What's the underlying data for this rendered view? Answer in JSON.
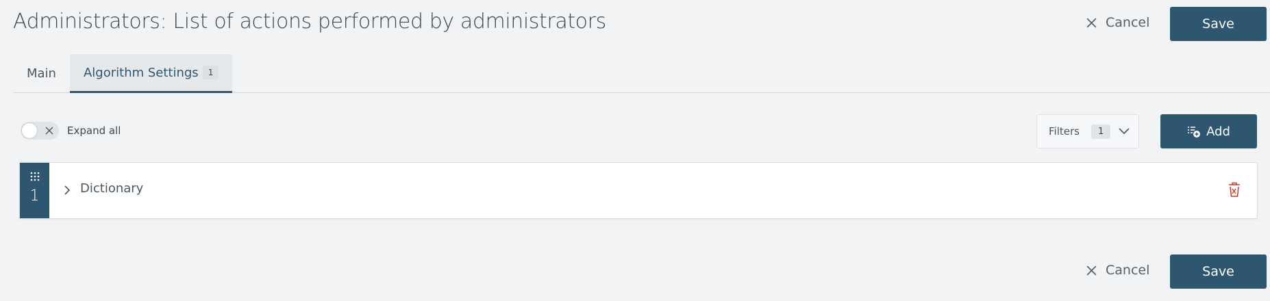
{
  "header": {
    "title": "Administrators: List of actions performed by administrators",
    "cancel_label": "Cancel",
    "save_label": "Save"
  },
  "tabs": [
    {
      "label": "Main",
      "active": false
    },
    {
      "label": "Algorithm Settings",
      "badge": "1",
      "active": true
    }
  ],
  "toolbar": {
    "expand_all_label": "Expand all",
    "expand_all_on": false,
    "filters_label": "Filters",
    "filters_count": "1",
    "add_label": "Add"
  },
  "rows": [
    {
      "number": "1",
      "title": "Dictionary"
    }
  ],
  "footer": {
    "cancel_label": "Cancel",
    "save_label": "Save"
  },
  "colors": {
    "primary": "#2f5671",
    "background": "#f1f3f5",
    "delete": "#c0392b"
  }
}
